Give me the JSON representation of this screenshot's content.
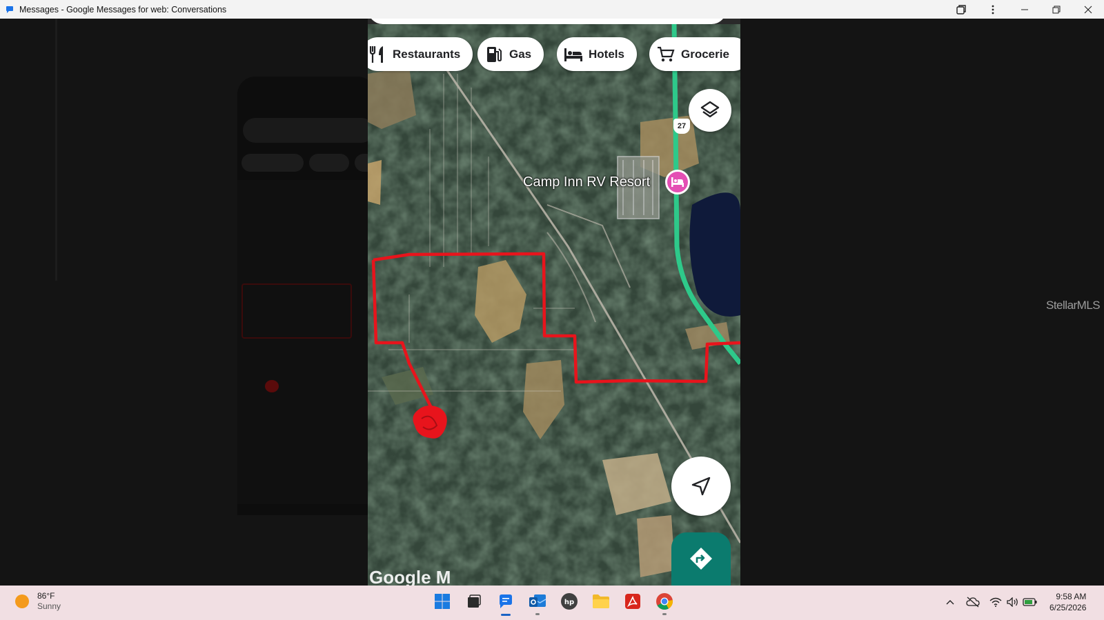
{
  "window": {
    "title": "Messages - Google Messages for web: Conversations",
    "buttons": [
      "extensions-icon",
      "more-icon",
      "minimize-icon",
      "restore-icon",
      "close-icon"
    ]
  },
  "map": {
    "chips": [
      {
        "label": "Restaurants",
        "icon": "restaurant-icon"
      },
      {
        "label": "Gas",
        "icon": "gas-pump-icon"
      },
      {
        "label": "Hotels",
        "icon": "bed-icon"
      },
      {
        "label": "Grocerie",
        "icon": "cart-icon"
      }
    ],
    "route_number": "27",
    "place_label": "Camp Inn RV Resort",
    "watermark": "Google M",
    "colors": {
      "route": "#2ec98a",
      "boundary": "#e8141c",
      "pin": "#e44fb4",
      "directions": "#0b7b6e"
    }
  },
  "overlay_watermark": "StellarMLS",
  "taskbar": {
    "weather_temp": "86°F",
    "weather_condition": "Sunny",
    "apps": [
      "windows-start-icon",
      "task-view-icon",
      "messages-icon",
      "outlook-icon",
      "hp-icon",
      "file-explorer-icon",
      "acrobat-icon",
      "chrome-icon"
    ],
    "tray": [
      "chevron-up-icon",
      "cloud-off-icon",
      "wifi-icon",
      "speaker-icon",
      "battery-icon"
    ],
    "time": "9:58 AM",
    "date": "6/25/2026"
  }
}
